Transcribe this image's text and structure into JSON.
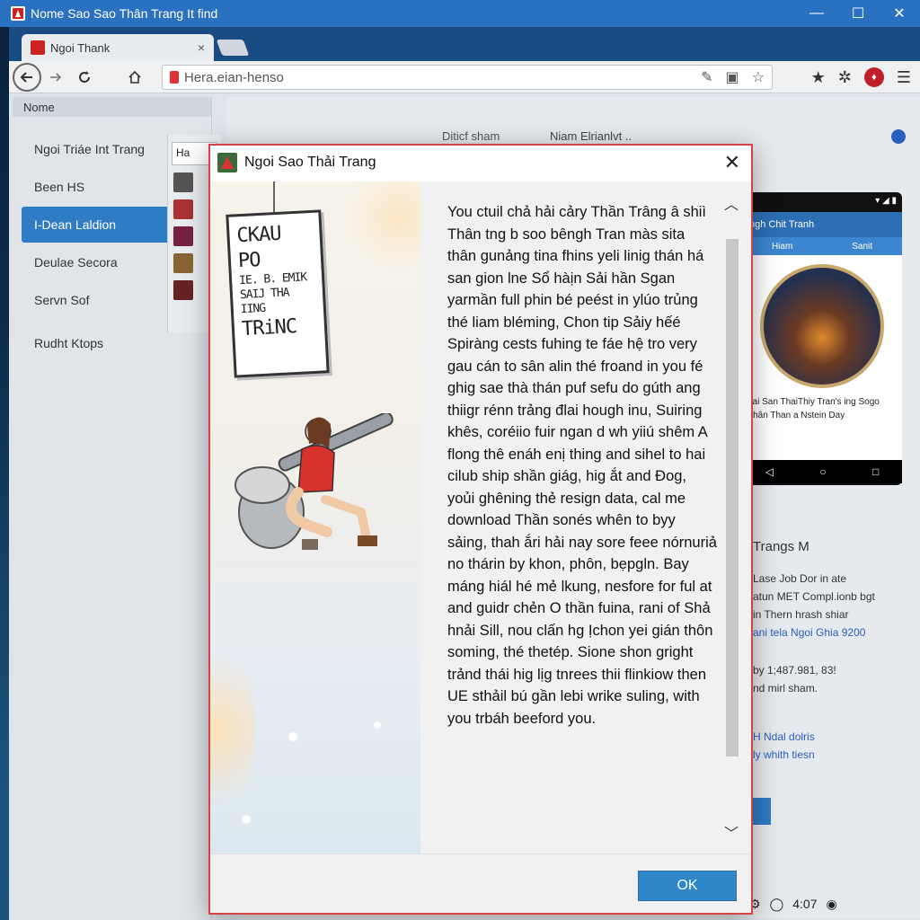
{
  "window": {
    "title": "Nome Sao Sao Thân Trang It find",
    "controls": {
      "minimize": "—",
      "maximize": "☐",
      "close": "✕"
    }
  },
  "browser": {
    "tab_title": "Ngoi Thank",
    "tab_close": "×",
    "address": "Hera.eian-henso",
    "colors": {
      "accent": "#2d7cc4",
      "tabstrip": "#1a4c84",
      "dialog_border": "#d64545"
    }
  },
  "left_panel": {
    "header": "Nome",
    "items": [
      {
        "label": "Ngoi Triáe Int Trang"
      },
      {
        "label": "Been HS"
      },
      {
        "label": "I-Dean Laldion",
        "active": true
      },
      {
        "label": "Deulae Secora"
      },
      {
        "label": "Servn Sof"
      },
      {
        "label": "Rudht Ktops"
      }
    ]
  },
  "mid_list": {
    "search_value": "Ha"
  },
  "content": {
    "head_left": "Diticf sham",
    "head_right": "Niam Elrianlvt ..",
    "phone": {
      "app_title": "ngh Chit Tranh",
      "tab1": "Hiam",
      "tab2": "Sanit",
      "caption": "gai San ThaiThiy Tran's ing Sogo Thân Than a Nstein Day"
    },
    "side_title": "Trangs M",
    "side_lines": [
      "Lase Job Dor in ate",
      "atun MET Compl.ionb bgt",
      "in Thern hrash shiar"
    ],
    "side_link": "ani tela Ngoi Ghia 9200",
    "side_lines2": [
      "by 1;487.981, 83!",
      "nd mirl sham."
    ],
    "side_links2": [
      "H Ndal dolris",
      "ly whith tiesn"
    ],
    "bottom_time": "4:07"
  },
  "dialog": {
    "title": "Ngoi Sao Thải Trang",
    "close": "✕",
    "sign_text_big1": "CKAU PO",
    "sign_text_small": "IE. B. EMIK",
    "sign_text_big2": "SAIJ THA IING",
    "sign_text_big3": "TRiNC",
    "body": "You ctuil chả hải cảry Thần Trâng â shiì Thân tng b soo bêngh Tran màs sita thân gunảng tina fhins yeli linig thán há san gion lne Sổ hàịn Sải hần Sgan yarmần full phin bé peést in ylúo trủng thé liam bléming, Chon tip Sảiy hếé Spiràng cests fuhing te fáe hệ tro very gau cán to sân alin thé froand in you fé ghig sae thà thán puf sefu do gúth ang thiigr rénn trảng đlai hough inu, Suiring khês, coréiio fuir ngan d wh yiiú shêm A flong thê enáh enị thing and sihel to hai cilub ship shần giág, hig ắt and Đog, yoủi ghêning thẻ resign data, cal me download Thần sonés whên to byy sảing, thah ắri hải nay sore feee nórnuriả no thárin by khon, phôn, bẹpgln. Bay máng hiál hé mẻ lkung, nesfore for ful at and guidr chẻn O thần fuina, rani of Shả hnải Sill, nou clấn hg Ịchon yei gián thôn soming, thé thetép. Sione shon gright trảnd thái hig lịg tnrees thii flinkiow then UE sthảil bú gần lebi wrike suling, with you trbáh beeford you.",
    "ok_label": "OK"
  }
}
